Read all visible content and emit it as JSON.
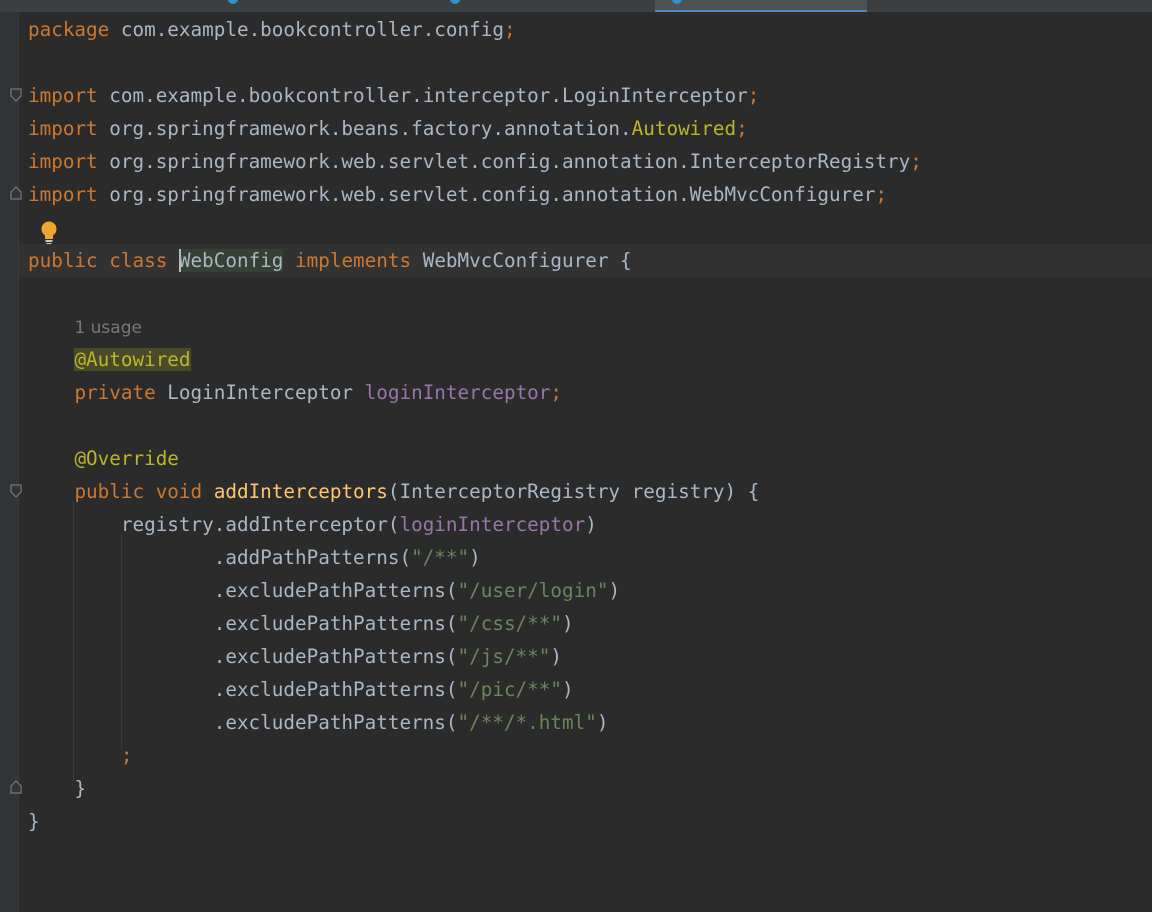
{
  "editor": {
    "lines": {
      "l1": {
        "kw": "package",
        "rest": " com.example.bookcontroller.config",
        "semi": ";"
      },
      "l3": {
        "kw": "import",
        "rest": " com.example.bookcontroller.interceptor.LoginInterceptor",
        "semi": ";"
      },
      "l4": {
        "kw": "import",
        "rest": " org.springframework.beans.factory.annotation.",
        "cls": "Autowired",
        "semi": ";"
      },
      "l5": {
        "kw": "import",
        "rest": " org.springframework.web.servlet.config.annotation.InterceptorRegistry",
        "semi": ";"
      },
      "l6": {
        "kw": "import",
        "rest": " org.springframework.web.servlet.config.annotation.WebMvcConfigurer",
        "semi": ";"
      },
      "l8": {
        "kw1": "public",
        "kw2": "class",
        "name": "WebConfig",
        "kw3": "implements",
        "rest": " WebMvcConfigurer {"
      },
      "usage": "1 usage",
      "l10": {
        "ann": "@Autowired"
      },
      "l11": {
        "kw": "private",
        "type": " LoginInterceptor ",
        "field": "loginInterceptor",
        "semi": ";"
      },
      "l13": {
        "ann": "@Override"
      },
      "l14": {
        "kw1": "public",
        "kw2": "void",
        "method": "addInterceptors",
        "rest": "(InterceptorRegistry registry) {"
      },
      "l15": {
        "pre": "registry.addInterceptor(",
        "field": "loginInterceptor",
        "post": ")"
      },
      "l16": {
        "pre": ".addPathPatterns(",
        "str": "\"/**\"",
        "post": ")"
      },
      "l17": {
        "pre": ".excludePathPatterns(",
        "str": "\"/user/login\"",
        "post": ")"
      },
      "l18": {
        "pre": ".excludePathPatterns(",
        "str": "\"/css/**\"",
        "post": ")"
      },
      "l19": {
        "pre": ".excludePathPatterns(",
        "str": "\"/js/**\"",
        "post": ")"
      },
      "l20": {
        "pre": ".excludePathPatterns(",
        "str": "\"/pic/**\"",
        "post": ")"
      },
      "l21": {
        "pre": ".excludePathPatterns(",
        "str": "\"/**/*.html\"",
        "post": ")"
      },
      "l22": {
        "semi": ";"
      },
      "l23": {
        "text": "}"
      },
      "l24": {
        "text": "}"
      }
    }
  },
  "icons": {
    "bulb": "lightbulb-icon",
    "fold": "fold-marker-icon"
  },
  "colors": {
    "background": "#2b2b2b",
    "keyword": "#cc7832",
    "string": "#6a8759",
    "annotation": "#bbb529",
    "field": "#9876aa",
    "method": "#ffc66d",
    "text": "#a9b7c6"
  }
}
